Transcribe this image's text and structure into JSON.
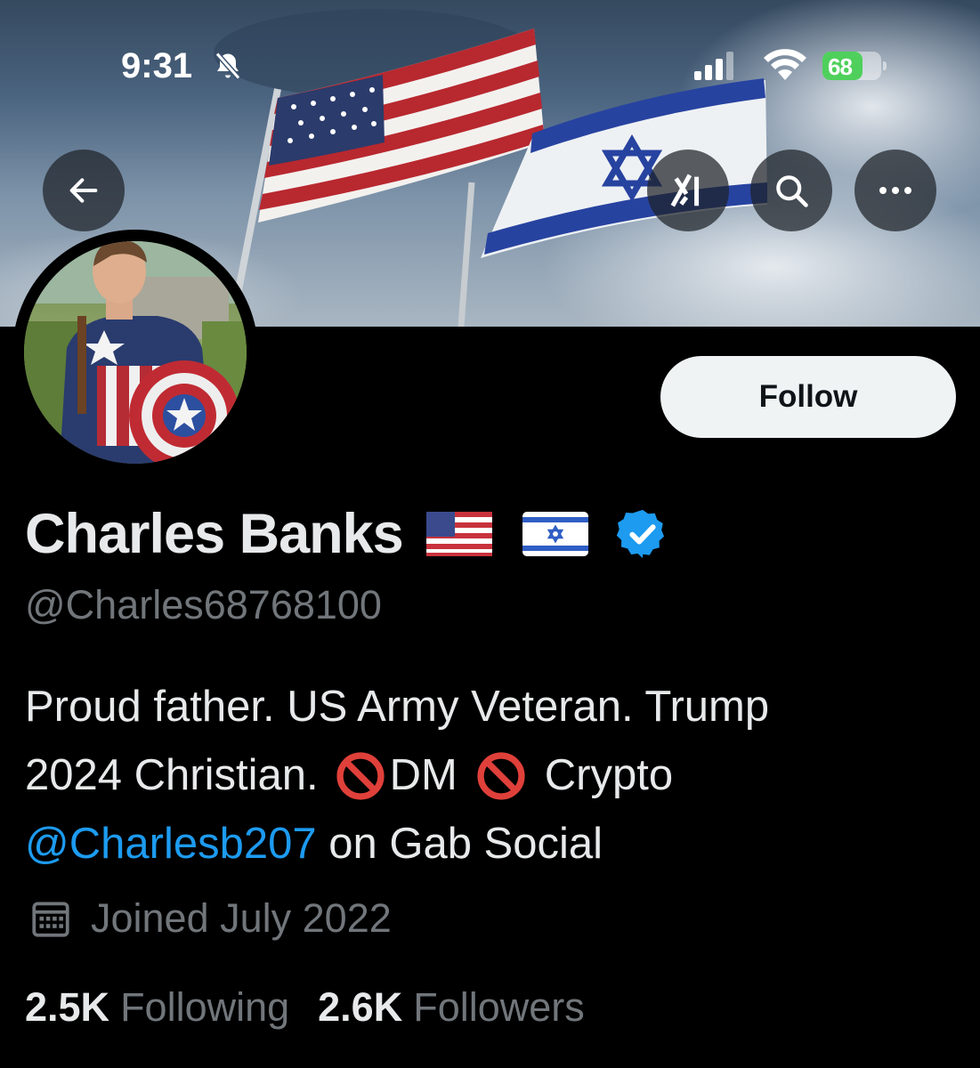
{
  "status_bar": {
    "time": "9:31",
    "battery_level": "68",
    "battery_fraction": 0.68,
    "battery_color": "#4fd05c"
  },
  "header": {
    "back_icon": "arrow-left-icon",
    "grok_icon": "grok-icon",
    "search_icon": "search-icon",
    "more_icon": "more-horizontal-icon"
  },
  "profile": {
    "display_name": "Charles Banks",
    "flags": [
      "us-flag-emoji",
      "israel-flag-emoji"
    ],
    "verified_color": "#1d9bf0",
    "handle": "@Charles68768100",
    "follow_label": "Follow",
    "bio": {
      "line1": "Proud father. US Army Veteran. Trump",
      "line2_a": "2024 Christian.",
      "line2_b": "DM",
      "line2_c": "Crypto",
      "line3_mention": "@Charlesb207",
      "line3_rest": " on Gab Social"
    },
    "joined": "Joined July 2022",
    "following_count": "2.5K",
    "following_label": "Following",
    "followers_count": "2.6K",
    "followers_label": "Followers"
  }
}
